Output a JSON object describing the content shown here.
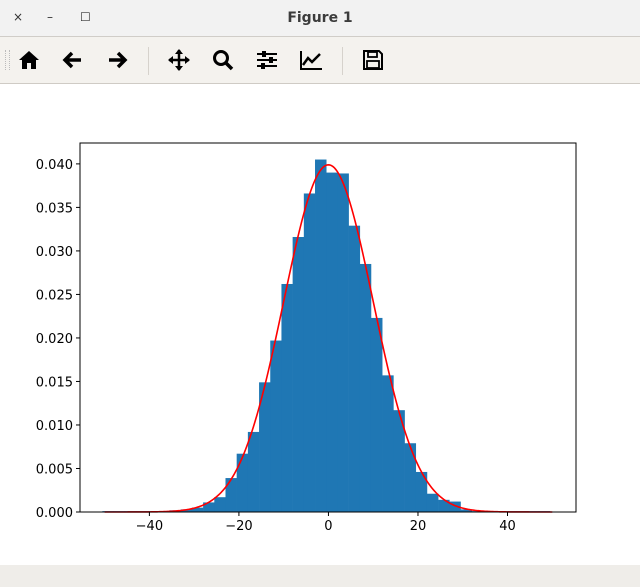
{
  "window": {
    "title": "Figure 1",
    "close": "×",
    "minimize": "–",
    "maximize": "☐"
  },
  "toolbar": {
    "buttons": [
      {
        "name": "home-button",
        "icon": "home-icon"
      },
      {
        "name": "back-button",
        "icon": "arrow-left-icon"
      },
      {
        "name": "forward-button",
        "icon": "arrow-right-icon"
      },
      {
        "name": "pan-button",
        "icon": "move-icon"
      },
      {
        "name": "zoom-button",
        "icon": "magnifier-icon"
      },
      {
        "name": "configure-subplots-button",
        "icon": "sliders-icon"
      },
      {
        "name": "edit-axis-button",
        "icon": "chart-line-icon"
      },
      {
        "name": "save-button",
        "icon": "floppy-disk-icon"
      }
    ]
  },
  "chart_data": {
    "type": "bar",
    "title": "",
    "xlabel": "",
    "ylabel": "",
    "xlim": [
      -55.5,
      55.3
    ],
    "ylim": [
      0,
      0.0424
    ],
    "grid": false,
    "histogram": {
      "bin_start": -50.5,
      "bin_width": 2.5,
      "color": "#1f77b4",
      "values": [
        0.0001,
        0.0001,
        0.0001,
        0.0001,
        0.0001,
        0.0001,
        0.0002,
        0.0003,
        0.0005,
        0.0011,
        0.0017,
        0.0039,
        0.0067,
        0.0092,
        0.0149,
        0.0197,
        0.0262,
        0.0316,
        0.0366,
        0.0405,
        0.039,
        0.0389,
        0.0329,
        0.0285,
        0.0223,
        0.0157,
        0.0117,
        0.0079,
        0.0046,
        0.0021,
        0.0014,
        0.0012,
        0.0003,
        0.0001,
        0.0001,
        0.0001,
        0.0001,
        0.0001,
        0.0001,
        0.0001
      ]
    },
    "curve": {
      "type": "line",
      "function": "normal_pdf",
      "mean": 0,
      "std": 10,
      "x_range": [
        -50,
        50
      ],
      "color": "#ff0000"
    },
    "xticks": [
      {
        "value": -40,
        "label": "−40"
      },
      {
        "value": -20,
        "label": "−20"
      },
      {
        "value": 0,
        "label": "0"
      },
      {
        "value": 20,
        "label": "20"
      },
      {
        "value": 40,
        "label": "40"
      }
    ],
    "yticks": [
      {
        "value": 0,
        "label": "0.000"
      },
      {
        "value": 0.005,
        "label": "0.005"
      },
      {
        "value": 0.01,
        "label": "0.010"
      },
      {
        "value": 0.015,
        "label": "0.015"
      },
      {
        "value": 0.02,
        "label": "0.020"
      },
      {
        "value": 0.025,
        "label": "0.025"
      },
      {
        "value": 0.03,
        "label": "0.030"
      },
      {
        "value": 0.035,
        "label": "0.035"
      },
      {
        "value": 0.04,
        "label": "0.040"
      }
    ]
  }
}
